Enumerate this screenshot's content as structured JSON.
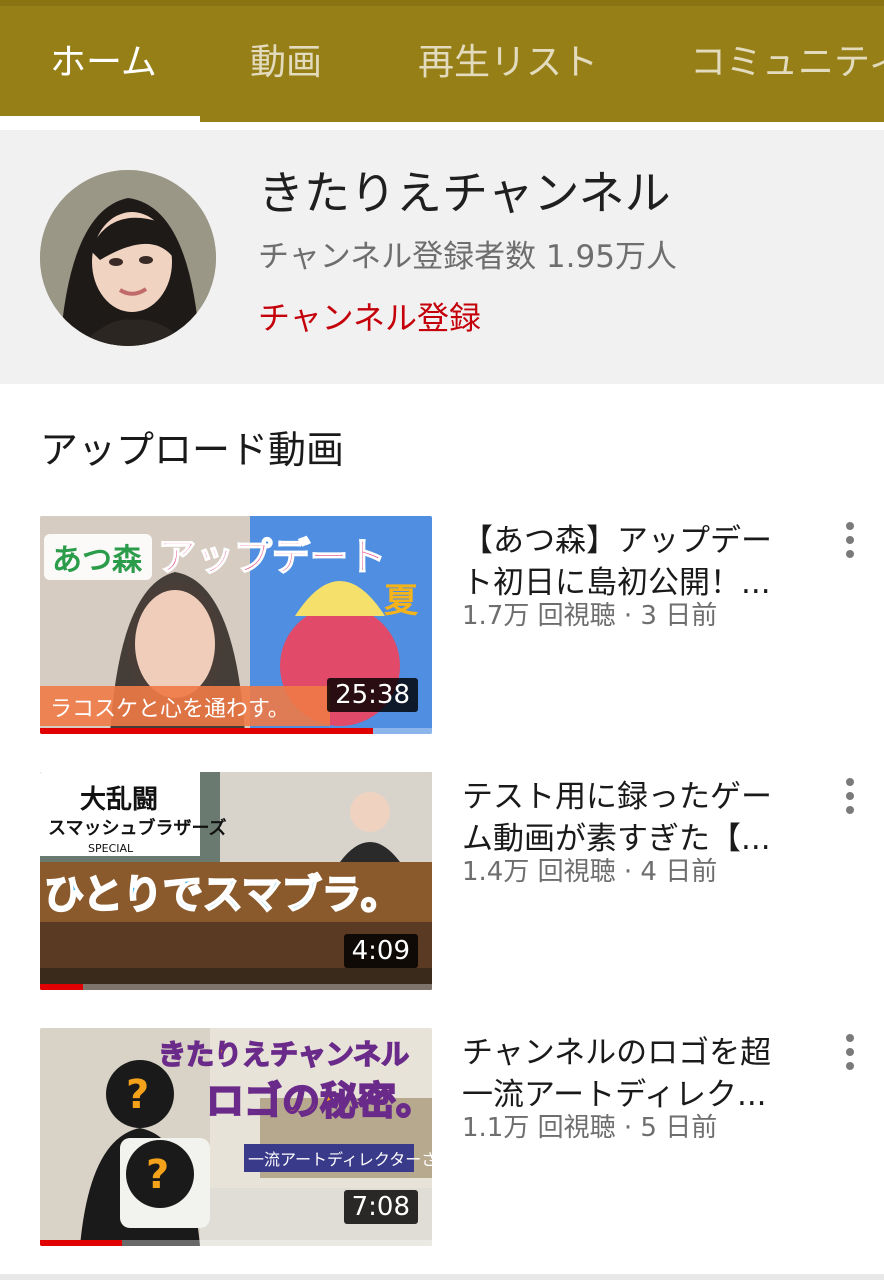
{
  "tabs": [
    {
      "label": "ホーム",
      "active": true
    },
    {
      "label": "動画",
      "active": false
    },
    {
      "label": "再生リスト",
      "active": false
    },
    {
      "label": "コミュニティ",
      "active": false
    }
  ],
  "channel": {
    "name": "きたりえチャンネル",
    "subscribers": "チャンネル登録者数 1.95万人",
    "subscribe_label": "チャンネル登録"
  },
  "section_title": "アップロード動画",
  "videos": [
    {
      "title_line1": "【あつ森】アップデー",
      "title_line2": "ト初日に島初公開！...",
      "meta": "1.7万 回視聴 · 3 日前",
      "duration": "25:38",
      "watched_fraction": 0.85,
      "thumb_text": {
        "tag": "あつ森",
        "headline": "アップデート",
        "season": "夏",
        "caption": "ラコスケと心を通わす。"
      }
    },
    {
      "title_line1": "テスト用に録ったゲー",
      "title_line2": "ム動画が素すぎた【...",
      "meta": "1.4万 回視聴 · 4 日前",
      "duration": "4:09",
      "watched_fraction": 0.11,
      "thumb_text": {
        "logo_line1": "大乱闘",
        "logo_line2": "スマッシュブラザーズ",
        "logo_line3": "SPECIAL",
        "headline": "ひとりでスマブラ。"
      }
    },
    {
      "title_line1": "チャンネルのロゴを超",
      "title_line2": "一流アートディレク...",
      "meta": "1.1万 回視聴 · 5 日前",
      "duration": "7:08",
      "watched_fraction": 0.21,
      "thumb_text": {
        "headline1": "きたりえチャンネル",
        "headline2": "ロゴの秘密。",
        "caption": "一流アートディレクターさん",
        "mark": "?"
      }
    }
  ],
  "colors": {
    "tabbar": "#977f17",
    "subscribe": "#c4000a",
    "progress": "#e00000"
  }
}
